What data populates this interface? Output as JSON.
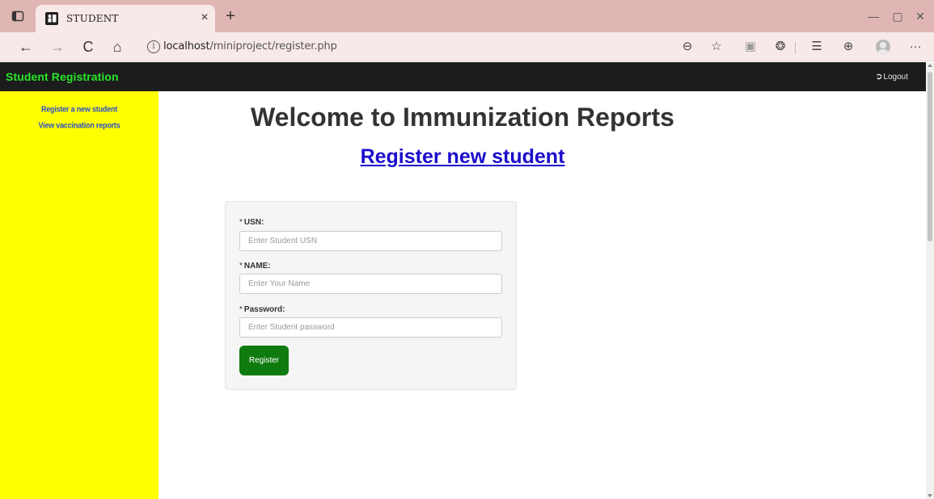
{
  "browser": {
    "tab_title": "STUDENT",
    "tab_close": "×",
    "new_tab": "+",
    "url_host": "localhost",
    "url_path": "/miniproject/register.php",
    "info_glyph": "i",
    "nav": {
      "back": "←",
      "forward": "→",
      "reload": "C",
      "home": "⌂"
    },
    "toolbar_icons": [
      "zoom-out-icon",
      "add-favorite-icon",
      "reading-view-icon",
      "extensions-icon",
      "favorites-icon",
      "collections-icon",
      "profile-icon",
      "more-icon"
    ],
    "toolbar_glyphs": {
      "zoom": "⊖",
      "favorite": "☆",
      "reading": "▣",
      "extensions": "❂",
      "favorites": "☰",
      "collections": "⊕",
      "more": "···"
    },
    "window": {
      "minimize": "—",
      "maximize": "▢",
      "close": "✕"
    }
  },
  "site": {
    "brand": "Student Registration",
    "logout_label": "Logout",
    "logout_icon": "➲"
  },
  "sidebar": {
    "items": [
      {
        "label": "Register a new student"
      },
      {
        "label": "View vaccination reports"
      }
    ]
  },
  "main": {
    "title": "Welcome to Immunization Reports",
    "subtitle_link": "Register new student"
  },
  "form": {
    "required_marker": "*",
    "fields": [
      {
        "label": "USN:",
        "placeholder": "Enter Student USN",
        "value": ""
      },
      {
        "label": "NAME:",
        "placeholder": "Enter Your Name",
        "value": ""
      },
      {
        "label": "Password:",
        "placeholder": "Enter Student password",
        "value": ""
      }
    ],
    "submit_label": "Register"
  },
  "colors": {
    "tabbar": "#dfb6b3",
    "navbar": "#1c1c1c",
    "brand": "#29e629",
    "sidebar": "#ffff00",
    "sidebar_link": "#2d4fc7",
    "link": "#1a0dcc",
    "button": "#0f7b0f"
  }
}
